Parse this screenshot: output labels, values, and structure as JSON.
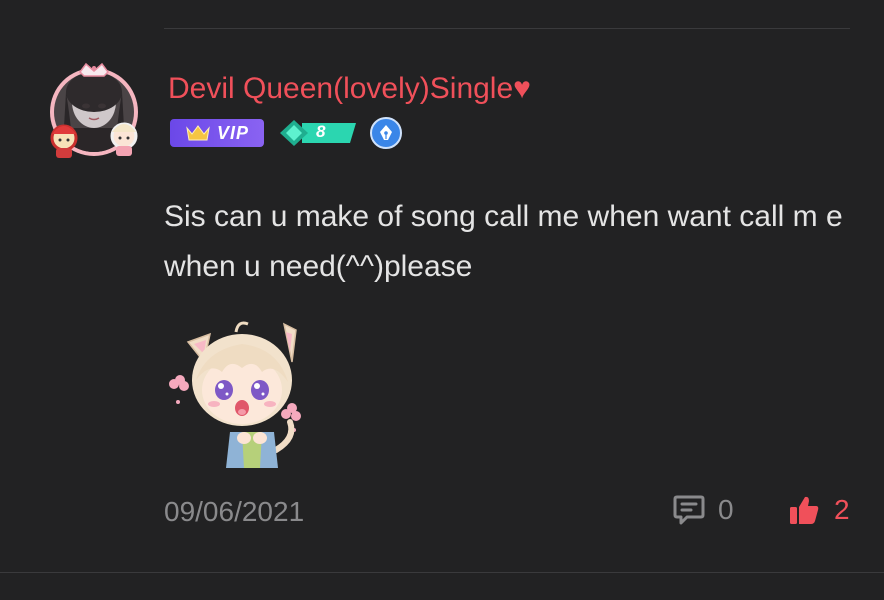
{
  "comment": {
    "author": {
      "name": "Devil Queen(lovely)Single",
      "name_suffix": "♥",
      "name_color": "#f0505a",
      "avatar": "anime-girl-avatar",
      "badges": {
        "vip_label": "VIP",
        "level": "8",
        "writer_icon": "pen-nib-icon"
      }
    },
    "text": "Sis can u make of song call me when want call m e when u need(^^)please",
    "sticker": "anime-cat-boy-sticker",
    "date": "09/06/2021",
    "reply_count": "0",
    "like_count": "2"
  },
  "icons": {
    "reply": "comment-bubble-icon",
    "like": "thumbs-up-icon",
    "vip": "crown-icon"
  },
  "colors": {
    "background": "#222223",
    "accent": "#f0505a",
    "vip": "#7a55ee",
    "level": "#2bd6b0",
    "text": "#e4e4e4",
    "muted": "#8a8a8c"
  }
}
